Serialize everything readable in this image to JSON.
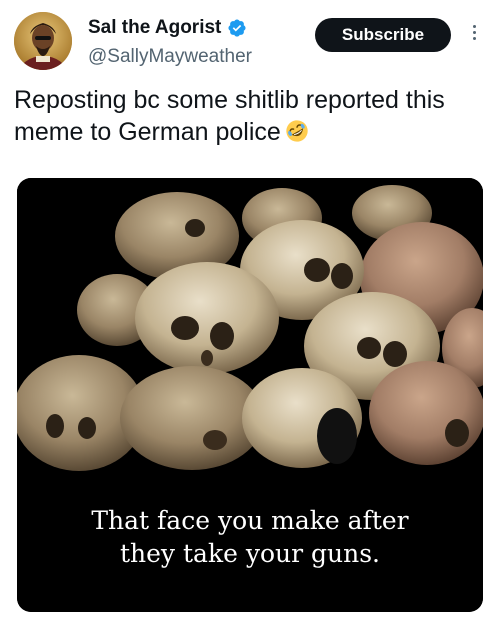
{
  "author": {
    "display_name": "Sal the Agorist",
    "handle": "@SallyMayweather",
    "verified": true,
    "avatar_icon": "profile-avatar"
  },
  "actions": {
    "subscribe_label": "Subscribe",
    "more_icon": "more-vertical-icon"
  },
  "tweet": {
    "text": "Reposting bc some shitlib reported this meme to German police",
    "emoji": "rolling-on-floor-laughing-emoji"
  },
  "media": {
    "caption_line1": "That face you make after",
    "caption_line2": "they take your guns."
  },
  "colors": {
    "text_primary": "#0f1419",
    "text_secondary": "#536471",
    "verified_blue": "#1d9bf0",
    "button_bg": "#0f1419",
    "media_bg": "#000000"
  }
}
